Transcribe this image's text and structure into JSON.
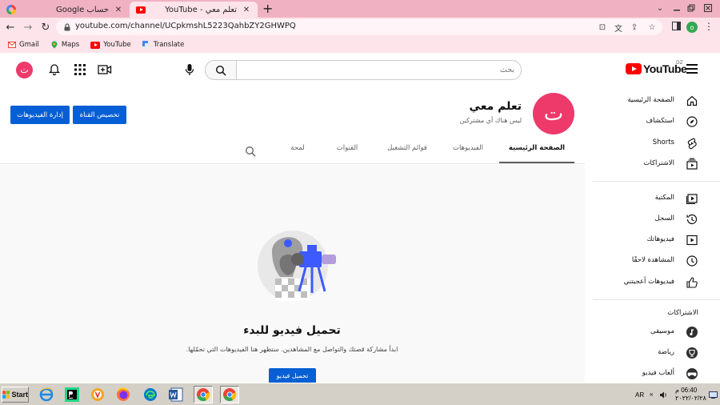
{
  "browser": {
    "tabs": [
      {
        "title": "حساب Google",
        "icon": "google-icon",
        "active": false
      },
      {
        "title": "تعلم معي - YouTube",
        "icon": "youtube-icon",
        "active": true
      }
    ],
    "url": "youtube.com/channel/UCpkmshL5223QahbZY2GHWPQ",
    "profile_initial": "o",
    "bookmarks": [
      {
        "label": "Gmail",
        "icon": "gmail-icon"
      },
      {
        "label": "Maps",
        "icon": "maps-icon"
      },
      {
        "label": "YouTube",
        "icon": "youtube-icon"
      },
      {
        "label": "Translate",
        "icon": "translate-icon"
      }
    ]
  },
  "masthead": {
    "logo_text": "YouTube",
    "country_code": "DZ",
    "search_placeholder": "بحث",
    "avatar_initial": "ت"
  },
  "channel": {
    "avatar_initial": "ت",
    "name": "تعلم معي",
    "subscribers": "ليس هناك أي مشتركين",
    "customize_label": "تخصيص القناة",
    "manage_label": "إدارة الفيديوهات",
    "tabs": [
      "الصفحة الرئيسية",
      "الفيديوهات",
      "قوائم التشغيل",
      "القنوات",
      "لمحة"
    ],
    "active_tab": 0,
    "empty": {
      "title": "تحميل فيديو للبدء",
      "subtitle": "ابدأ مشاركة قصتك والتواصل مع المشاهدين. ستظهر هنا الفيديوهات التي تحمّلها.",
      "button": "تحميل فيديو"
    }
  },
  "guide": {
    "main": [
      {
        "label": "الصفحة الرئيسية",
        "icon": "home-icon"
      },
      {
        "label": "استكشاف",
        "icon": "explore-icon"
      },
      {
        "label": "Shorts",
        "icon": "shorts-icon"
      },
      {
        "label": "الاشتراكات",
        "icon": "subscriptions-icon"
      }
    ],
    "library": [
      {
        "label": "المكتبة",
        "icon": "library-icon"
      },
      {
        "label": "السجل",
        "icon": "history-icon"
      },
      {
        "label": "فيديوهاتك",
        "icon": "your-videos-icon"
      },
      {
        "label": "المشاهدة لاحقًا",
        "icon": "watch-later-icon"
      },
      {
        "label": "فيديوهات أعجبتني",
        "icon": "liked-icon"
      }
    ],
    "subscriptions_header": "الاشتراكات",
    "subscriptions": [
      {
        "label": "موسيقى",
        "icon": "music-icon"
      },
      {
        "label": "رياضة",
        "icon": "sports-icon"
      },
      {
        "label": "ألعاب فيديو",
        "icon": "gaming-icon"
      }
    ]
  },
  "taskbar": {
    "start_label": "Start",
    "language": "AR",
    "time": "06:40 م",
    "date": "٢٠٢٢/٠٢/٢٨"
  }
}
